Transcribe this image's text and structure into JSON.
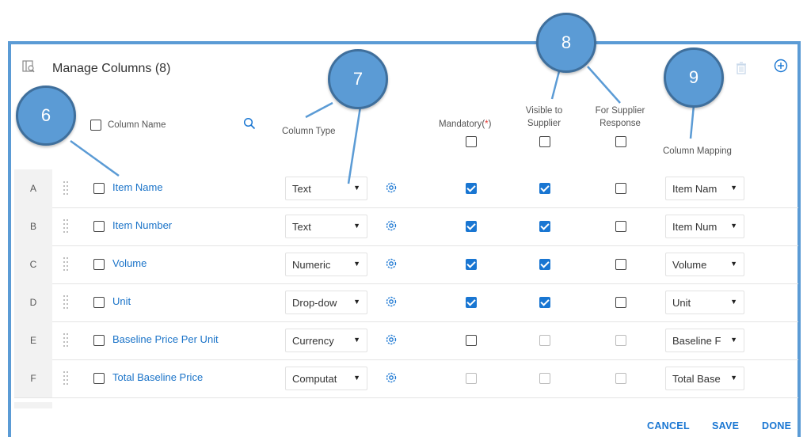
{
  "header": {
    "title": "Manage Columns (8)"
  },
  "columns": {
    "column_name": "Column Name",
    "column_type": "Column Type",
    "mandatory": "Mandatory(",
    "mandatory_star": "*",
    "mandatory_close": ")",
    "visible_line1": "Visible to",
    "visible_line2": "Supplier",
    "supplier_line1": "For Supplier",
    "supplier_line2": "Response",
    "column_mapping": "Column Mapping"
  },
  "rows": [
    {
      "letter": "A",
      "name": "Item Name",
      "type": "Text",
      "mandatory": "checked",
      "visible": "checked",
      "supplier": "unchecked",
      "mapping": "Item Nam"
    },
    {
      "letter": "B",
      "name": "Item Number",
      "type": "Text",
      "mandatory": "checked",
      "visible": "checked",
      "supplier": "unchecked",
      "mapping": "Item Num"
    },
    {
      "letter": "C",
      "name": "Volume",
      "type": "Numeric",
      "mandatory": "checked",
      "visible": "checked",
      "supplier": "unchecked",
      "mapping": "Volume"
    },
    {
      "letter": "D",
      "name": "Unit",
      "type": "Drop-dow",
      "mandatory": "checked",
      "visible": "checked",
      "supplier": "unchecked",
      "mapping": "Unit"
    },
    {
      "letter": "E",
      "name": "Baseline Price Per Unit",
      "type": "Currency",
      "mandatory": "unchecked",
      "visible": "disabled",
      "supplier": "disabled",
      "mapping": "Baseline F"
    },
    {
      "letter": "F",
      "name": "Total Baseline Price",
      "type": "Computat",
      "mandatory": "disabled",
      "visible": "disabled",
      "supplier": "disabled",
      "mapping": "Total Base"
    }
  ],
  "footer": {
    "cancel": "CANCEL",
    "save": "SAVE",
    "done": "DONE"
  },
  "callouts": [
    "6",
    "7",
    "8",
    "9"
  ],
  "colors": {
    "accent": "#1976d2",
    "callout": "#5b9bd5",
    "border": "#5b9bd5"
  }
}
